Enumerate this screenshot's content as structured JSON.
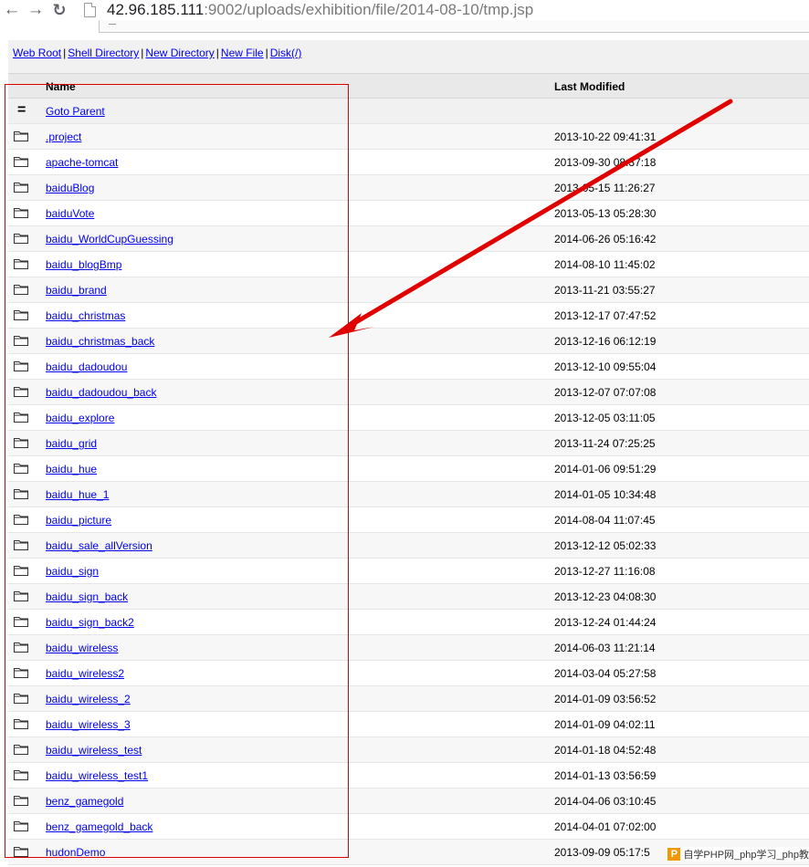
{
  "browser": {
    "url_host": "42.96.185.111",
    "url_rest": ":9002/uploads/exhibition/file/2014-08-10/tmp.jsp"
  },
  "toolbar": {
    "links": [
      "Web Root",
      "Shell Directory",
      "New Directory",
      "New File",
      "Disk(/)"
    ],
    "separator": "|"
  },
  "table": {
    "col_name": "Name",
    "col_modified": "Last Modified",
    "parent_label": "Goto Parent",
    "parent_icon": "=",
    "rows": [
      {
        "name": ".project",
        "date": "2013-10-22 09:41:31"
      },
      {
        "name": "apache-tomcat",
        "date": "2013-09-30 08:37:18"
      },
      {
        "name": "baiduBlog",
        "date": "2013-05-15 11:26:27"
      },
      {
        "name": "baiduVote",
        "date": "2013-05-13 05:28:30"
      },
      {
        "name": "baidu_WorldCupGuessing",
        "date": "2014-06-26 05:16:42"
      },
      {
        "name": "baidu_blogBmp",
        "date": "2014-08-10 11:45:02"
      },
      {
        "name": "baidu_brand",
        "date": "2013-11-21 03:55:27"
      },
      {
        "name": "baidu_christmas",
        "date": "2013-12-17 07:47:52"
      },
      {
        "name": "baidu_christmas_back",
        "date": "2013-12-16 06:12:19"
      },
      {
        "name": "baidu_dadoudou",
        "date": "2013-12-10 09:55:04"
      },
      {
        "name": "baidu_dadoudou_back",
        "date": "2013-12-07 07:07:08"
      },
      {
        "name": "baidu_explore",
        "date": "2013-12-05 03:11:05"
      },
      {
        "name": "baidu_grid",
        "date": "2013-11-24 07:25:25"
      },
      {
        "name": "baidu_hue",
        "date": "2014-01-06 09:51:29"
      },
      {
        "name": "baidu_hue_1",
        "date": "2014-01-05 10:34:48"
      },
      {
        "name": "baidu_picture",
        "date": "2014-08-04 11:07:45"
      },
      {
        "name": "baidu_sale_allVersion",
        "date": "2013-12-12 05:02:33"
      },
      {
        "name": "baidu_sign",
        "date": "2013-12-27 11:16:08"
      },
      {
        "name": "baidu_sign_back",
        "date": "2013-12-23 04:08:30"
      },
      {
        "name": "baidu_sign_back2",
        "date": "2013-12-24 01:44:24"
      },
      {
        "name": "baidu_wireless",
        "date": "2014-06-03 11:21:14"
      },
      {
        "name": "baidu_wireless2",
        "date": "2014-03-04 05:27:58"
      },
      {
        "name": "baidu_wireless_2",
        "date": "2014-01-09 03:56:52"
      },
      {
        "name": "baidu_wireless_3",
        "date": "2014-01-09 04:02:11"
      },
      {
        "name": "baidu_wireless_test",
        "date": "2014-01-18 04:52:48"
      },
      {
        "name": "baidu_wireless_test1",
        "date": "2014-01-13 03:56:59"
      },
      {
        "name": "benz_gamegold",
        "date": "2014-04-06 03:10:45"
      },
      {
        "name": "benz_gamegold_back",
        "date": "2014-04-01 07:02:00"
      },
      {
        "name": "hudonDemo",
        "date": "2013-09-09 05:17:5"
      }
    ]
  },
  "watermark": {
    "logo": "P",
    "text": "自学PHP网_php学习_php教"
  },
  "colors": {
    "link": "#0000ee",
    "annotation": "#e00000",
    "watermark_logo": "#f39800"
  },
  "icons": {
    "back": "arrow-left-icon",
    "forward": "arrow-right-icon",
    "reload": "reload-icon",
    "page": "page-icon",
    "folder": "folder-icon"
  }
}
